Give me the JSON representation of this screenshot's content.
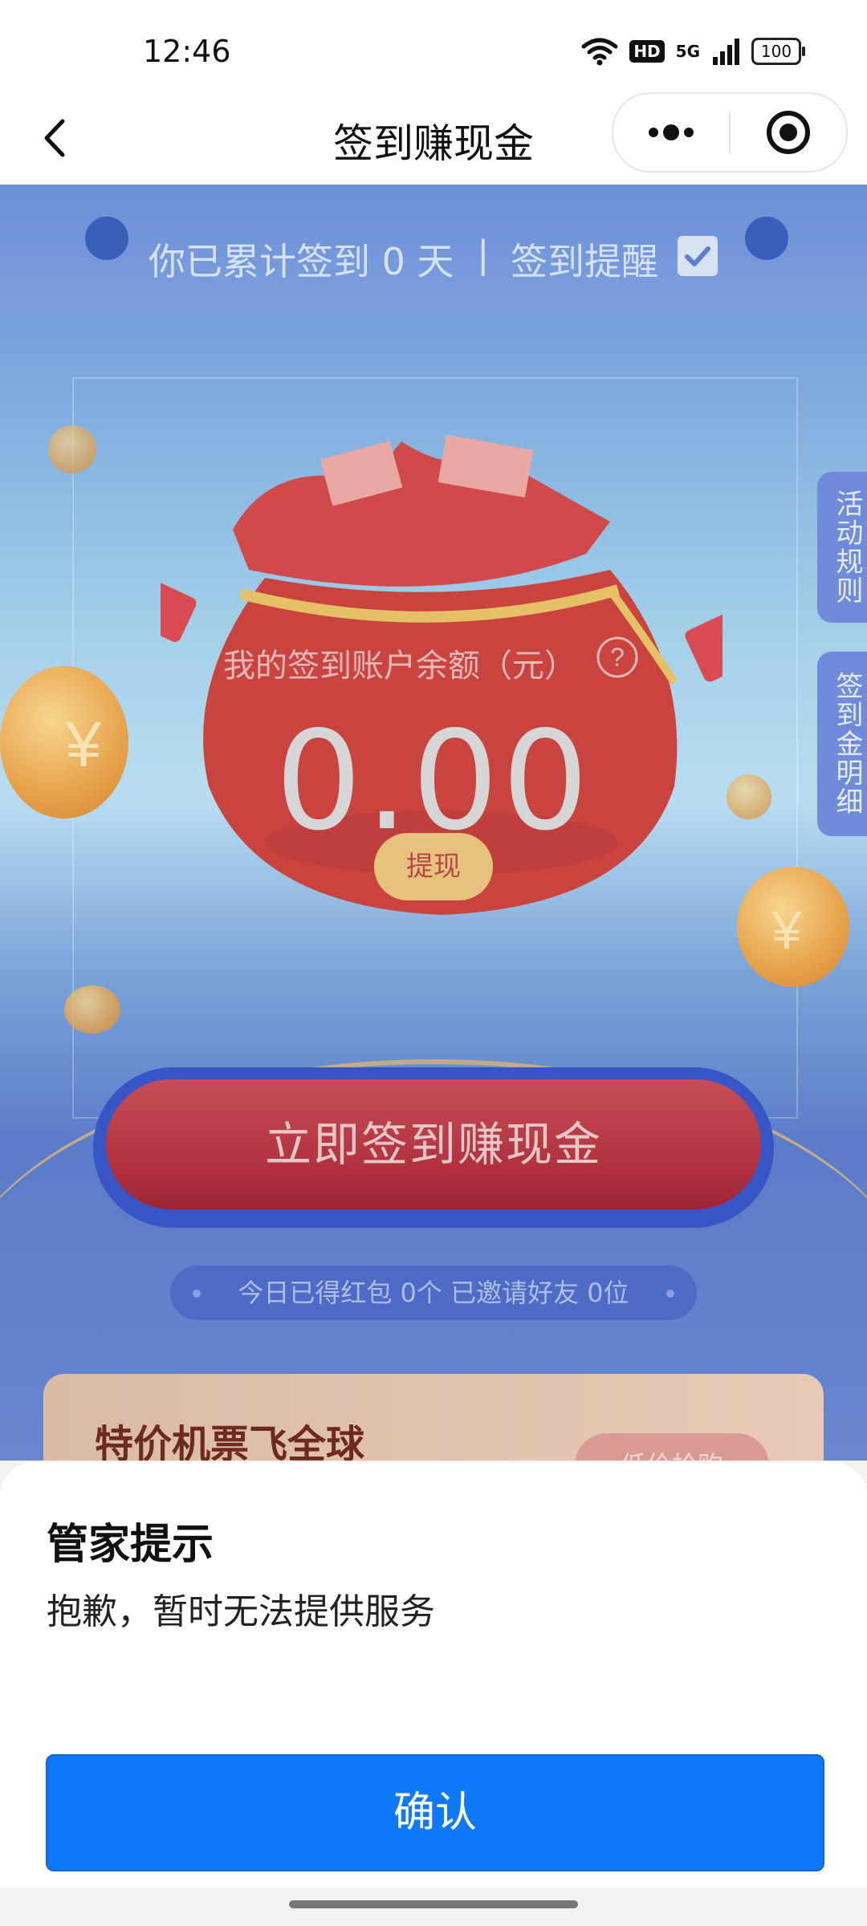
{
  "status_bar": {
    "time": "12:46",
    "hd": "HD",
    "network": "5G",
    "battery": "100"
  },
  "nav": {
    "title": "签到赚现金"
  },
  "streak": {
    "text": "你已累计签到 0 天",
    "separator": "|",
    "reminder_label": "签到提醒",
    "reminder_checked": true
  },
  "side_tabs": {
    "rules": "活动规则",
    "details": "签到金明细"
  },
  "balance": {
    "label": "我的签到账户余额（元）",
    "help": "?",
    "value": "0.00",
    "withdraw_label": "提现"
  },
  "signin_button": "立即签到赚现金",
  "stats": "今日已得红包 0个 已邀请好友 0位",
  "promo": {
    "title": "特价机票飞全球",
    "button": "低价抢购"
  },
  "modal": {
    "title": "管家提示",
    "message": "抱歉，暂时无法提供服务",
    "confirm": "确认"
  },
  "colors": {
    "confirm_blue": "#1079FA",
    "signin_red": "#B0303E",
    "bag_red": "#C94A4A"
  }
}
